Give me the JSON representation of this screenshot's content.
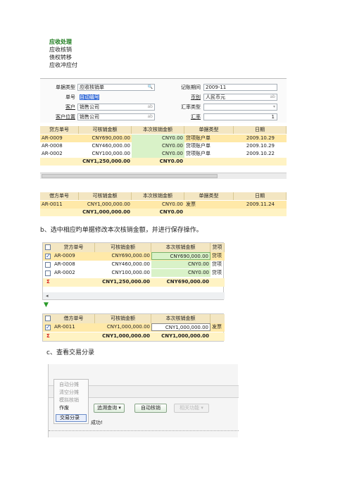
{
  "section1": {
    "menu": [
      "应收处理",
      "应收核销",
      "债权转移",
      "应收冲应付"
    ],
    "form": {
      "doc_type_label": "单据类型",
      "doc_type_value": "应收核销单",
      "period_label": "记账期间",
      "period_value": "2009-11",
      "doc_no_label": "单号",
      "doc_no_value": "自动编号",
      "currency_label": "币别",
      "currency_value": "人民币元",
      "customer_label": "客户",
      "customer_value": "销售公司",
      "rate_type_label": "汇率类型",
      "customer_pos_label": "客户位置",
      "customer_pos_value": "销售公司",
      "rate_label": "汇率",
      "rate_value": "1",
      "ab": "ab"
    },
    "debit_headers": [
      "贷方单号",
      "可核销金额",
      "本次核销金额",
      "单据类型",
      "日期"
    ],
    "debit_rows": [
      [
        "AR-0009",
        "CNY690,000.00",
        "CNY0.00",
        "贷项账户单",
        "2009.10.29"
      ],
      [
        "AR-0008",
        "CNY460,000.00",
        "CNY0.00",
        "贷项账户单",
        "2009.10.29"
      ],
      [
        "AR-0002",
        "CNY100,000.00",
        "CNY0.00",
        "贷项账户单",
        "2009.10.22"
      ]
    ],
    "debit_total": [
      "CNY1,250,000.00",
      "CNY0.00"
    ],
    "credit_headers": [
      "借方单号",
      "可核销金额",
      "本次核销金额",
      "单据类型",
      "日期"
    ],
    "credit_rows": [
      [
        "AR-0011",
        "CNY1,000,000.00",
        "CNY0.00",
        "发票",
        "2009.11.24"
      ]
    ],
    "credit_total": [
      "CNY1,000,000.00",
      "CNY0.00"
    ]
  },
  "caption_b": "b、选中相应旳单据修改本次核销金额，并进行保存操作。",
  "section2": {
    "debit_headers": [
      "贷方单号",
      "可核销金额",
      "本次核销金额",
      "贷项"
    ],
    "debit_rows": [
      [
        "AR-0009",
        "CNY690,000.00",
        "CNY690,000.00",
        "贷项"
      ],
      [
        "AR-0008",
        "CNY460,000.00",
        "CNY0.00",
        "贷项"
      ],
      [
        "AR-0002",
        "CNY100,000.00",
        "CNY0.00",
        "贷项"
      ]
    ],
    "debit_total": [
      "CNY1,250,000.00",
      "CNY690,000.00"
    ],
    "credit_headers": [
      "借方单号",
      "可核销金额",
      "本次核销金额"
    ],
    "credit_rows": [
      [
        "AR-0011",
        "CNY1,000,000.00",
        "CNY1,000,000.00",
        "发票"
      ]
    ],
    "credit_total": [
      "CNY1,000,000.00",
      "CNY1,000,000.00"
    ],
    "sigma": "Σ"
  },
  "caption_c": "c、查看交易分录",
  "section3": {
    "context_menu": [
      "自动分摊",
      "清空分摊",
      "模拟核销",
      "作废",
      "交易分录"
    ],
    "buttons": [
      "追溯查询",
      "自动核销",
      "相关功能"
    ],
    "status": "成功!"
  },
  "colors": {
    "header": "#f3e6c2",
    "selected": "#ffe9a8",
    "total": "#fff3c4",
    "edit": "#d9f2c8",
    "link": "#1a7a1a"
  }
}
